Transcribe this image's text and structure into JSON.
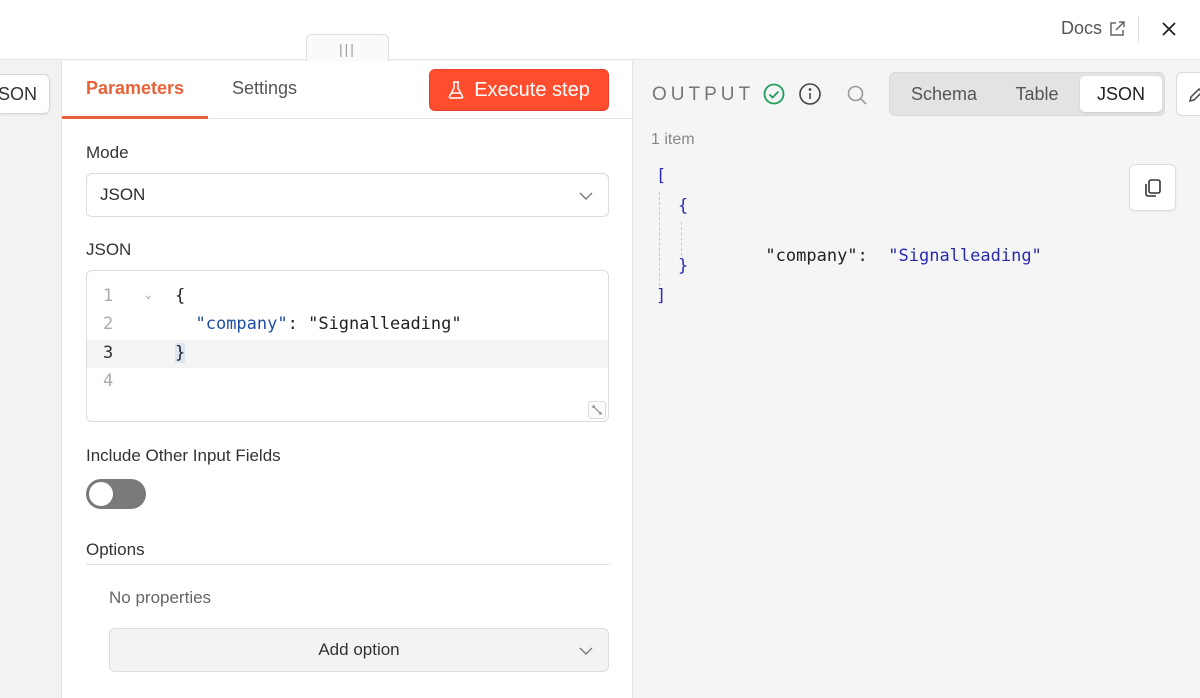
{
  "header": {
    "docs_label": "Docs",
    "drag_handle": "|||"
  },
  "left_panel": {
    "input_view_label": "JSON"
  },
  "node_panel": {
    "tabs": [
      {
        "label": "Parameters",
        "active": true
      },
      {
        "label": "Settings",
        "active": false
      }
    ],
    "execute_label": "Execute step",
    "mode_label": "Mode",
    "mode_value": "JSON",
    "json_label": "JSON",
    "editor": {
      "line_numbers": [
        "1",
        "2",
        "3",
        "4"
      ],
      "active_line": 3,
      "lines": [
        "{",
        "  \"company\": \"Signalleading\"",
        "}",
        ""
      ]
    },
    "include_label": "Include Other Input Fields",
    "include_enabled": false,
    "options_label": "Options",
    "no_properties": "No properties",
    "add_option_label": "Add option"
  },
  "output_panel": {
    "title": "OUTPUT",
    "status": "success",
    "view_tabs": [
      {
        "label": "Schema",
        "active": false
      },
      {
        "label": "Table",
        "active": false
      },
      {
        "label": "JSON",
        "active": true
      }
    ],
    "item_count": "1 item",
    "json_lines": {
      "open_array": "[",
      "open_obj": "{",
      "key": "\"company\":",
      "value": "\"Signalleading\"",
      "close_obj": "}",
      "close_array": "]"
    }
  },
  "colors": {
    "accent": "#e8623a",
    "execute_bg": "#ff4d2e",
    "success": "#1e9e5a"
  }
}
